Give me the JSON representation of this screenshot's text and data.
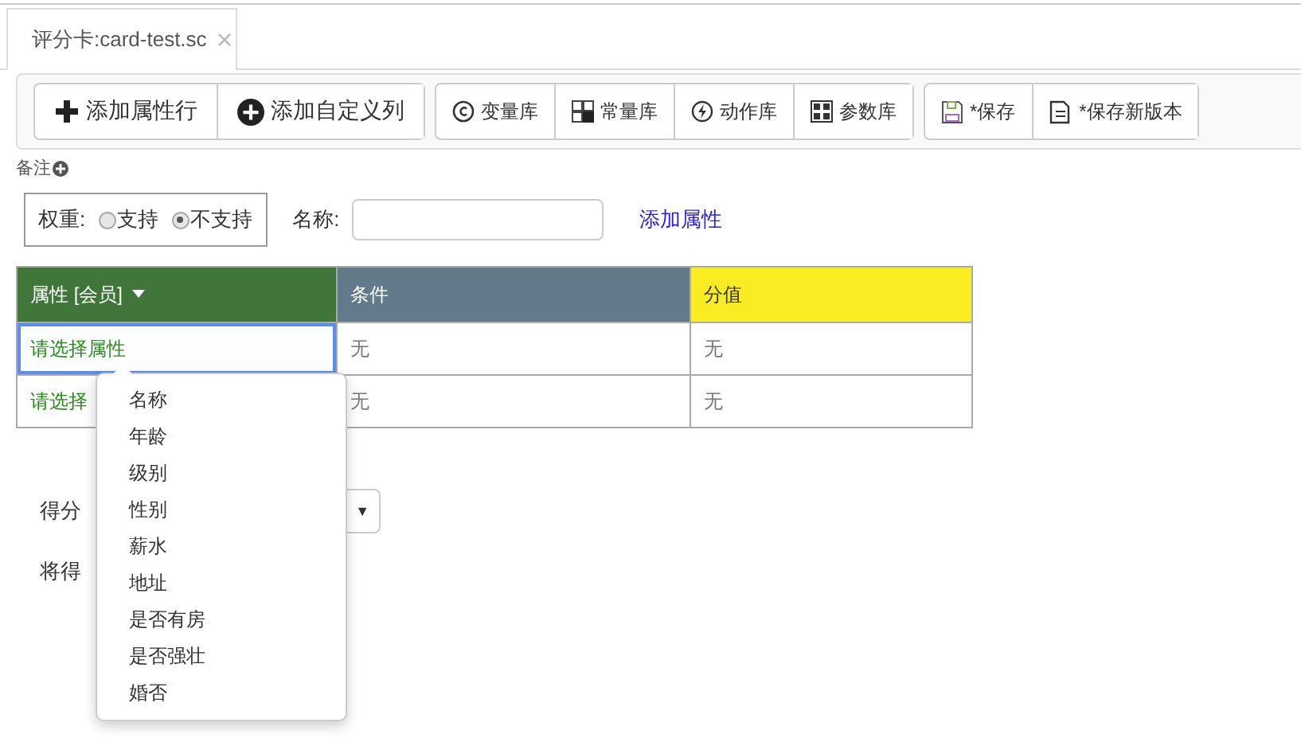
{
  "tabs": [
    {
      "label": "评分卡:card-test.sc",
      "close": "×",
      "selected": true
    }
  ],
  "toolbar": {
    "groups": [
      [
        {
          "label": "添加属性行",
          "kind": "plus"
        },
        {
          "label": "添加自定义列",
          "kind": "plus-circle"
        }
      ],
      [
        {
          "label": "变量库",
          "kind": "copyright"
        },
        {
          "label": "常量库",
          "kind": "squares"
        },
        {
          "label": "动作库",
          "kind": "bolt"
        },
        {
          "label": "参数库",
          "kind": "grid"
        }
      ],
      [
        {
          "label": "*保存",
          "kind": "floppy"
        },
        {
          "label": "*保存新版本",
          "kind": "doc"
        }
      ]
    ]
  },
  "note": {
    "label": "备注"
  },
  "weight": {
    "label": "权重:",
    "options": [
      {
        "label": "支持",
        "selected": false
      },
      {
        "label": "不支持",
        "selected": true
      }
    ]
  },
  "name": {
    "label": "名称:"
  },
  "add_attribute_link": "添加属性",
  "table": {
    "columns": [
      {
        "label": "属性 [会员]",
        "color": "#41763b",
        "dropdown": true
      },
      {
        "label": "条件",
        "color": "#627a89",
        "dropdown": false
      },
      {
        "label": "分值",
        "color": "#f9ec22",
        "dropdown": false
      }
    ],
    "rows": [
      {
        "focused": true,
        "cells": [
          "请选择属性",
          "无",
          "无"
        ]
      },
      {
        "focused": false,
        "cells": [
          "请选择",
          "无",
          "无"
        ]
      }
    ]
  },
  "attribute_menu": [
    "名称",
    "年龄",
    "级别",
    "性别",
    "薪水",
    "地址",
    "是否有房",
    "是否强壮",
    "婚否"
  ],
  "score_row": {
    "label": "得分",
    "select_arrow": "▼"
  },
  "assign_row": {
    "label": "将得"
  }
}
